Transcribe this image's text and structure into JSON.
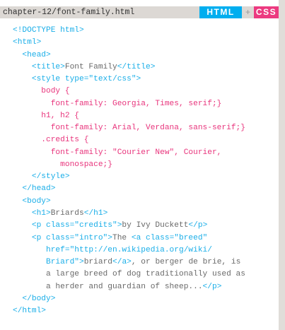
{
  "header": {
    "file_path": "chapter-12/font-family.html",
    "tab_html": "HTML",
    "separator": "+",
    "tab_css": "CSS"
  },
  "colors": {
    "html_tab": "#00aeef",
    "css_tab": "#ec3a80",
    "tag": "#1aaee8",
    "css": "#e8347c",
    "text": "#6a6a6a"
  },
  "code_lines": [
    [
      [
        "b",
        "<!DOCTYPE html>"
      ]
    ],
    [
      [
        "b",
        "<html>"
      ]
    ],
    [
      [
        "b",
        "  <head>"
      ]
    ],
    [
      [
        "b",
        "    <title>"
      ],
      [
        "g",
        "Font Family"
      ],
      [
        "b",
        "</title>"
      ]
    ],
    [
      [
        "b",
        "    <style type=\"text/css\">"
      ]
    ],
    [
      [
        "p",
        "      body {"
      ]
    ],
    [
      [
        "p",
        "        font-family: Georgia, Times, serif;}"
      ]
    ],
    [
      [
        "p",
        "      h1, h2 {"
      ]
    ],
    [
      [
        "p",
        "        font-family: Arial, Verdana, sans-serif;}"
      ]
    ],
    [
      [
        "p",
        "      .credits {"
      ]
    ],
    [
      [
        "p",
        "        font-family: \"Courier New\", Courier,"
      ]
    ],
    [
      [
        "p",
        "          monospace;}"
      ]
    ],
    [
      [
        "b",
        "    </style>"
      ]
    ],
    [
      [
        "b",
        "  </head>"
      ]
    ],
    [
      [
        "b",
        "  <body>"
      ]
    ],
    [
      [
        "b",
        "    <h1>"
      ],
      [
        "g",
        "Briards"
      ],
      [
        "b",
        "</h1>"
      ]
    ],
    [
      [
        "b",
        "    <p class=\"credits\">"
      ],
      [
        "g",
        "by Ivy Duckett"
      ],
      [
        "b",
        "</p>"
      ]
    ],
    [
      [
        "b",
        "    <p class=\"intro\">"
      ],
      [
        "g",
        "The "
      ],
      [
        "b",
        "<a class=\"breed\""
      ]
    ],
    [
      [
        "b",
        "       href=\"http://en.wikipedia.org/wiki/"
      ]
    ],
    [
      [
        "b",
        "       Briard\">"
      ],
      [
        "g",
        "briard"
      ],
      [
        "b",
        "</a>"
      ],
      [
        "g",
        ", or berger de brie, is"
      ]
    ],
    [
      [
        "g",
        "       a large breed of dog traditionally used as"
      ]
    ],
    [
      [
        "g",
        "       a herder and guardian of sheep..."
      ],
      [
        "b",
        "</p>"
      ]
    ],
    [
      [
        "b",
        "  </body>"
      ]
    ],
    [
      [
        "b",
        "</html>"
      ]
    ]
  ]
}
